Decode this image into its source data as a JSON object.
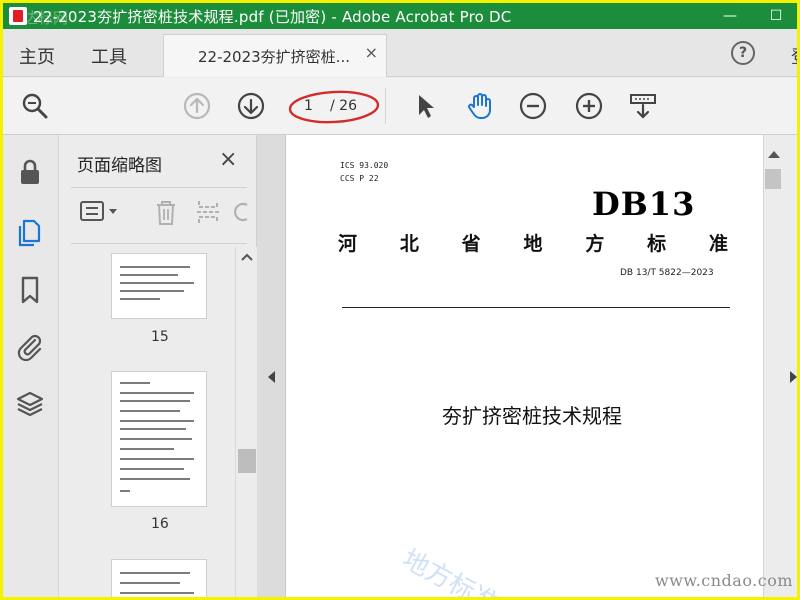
{
  "window": {
    "title": "22-2023夯扩挤密桩技术规程.pdf  (已加密)  - Adobe Acrobat Pro DC",
    "watermark": "达标网",
    "minimize": "—",
    "maximize": "☐"
  },
  "tabs": {
    "home": "主页",
    "tools": "工具",
    "document_tab": "22-2023夯扩挤密桩...",
    "close": "×",
    "help": "?",
    "overflow": "登"
  },
  "toolbar": {
    "current_page": "1",
    "total_pages": "/ 26",
    "icons": [
      "zoom-search-icon",
      "page-up-icon",
      "page-down-icon",
      "select-arrow-icon",
      "hand-icon",
      "zoom-out-icon",
      "zoom-in-icon",
      "keyboard-marquee-icon"
    ]
  },
  "panel": {
    "title": "页面缩略图",
    "close": "×",
    "thumbnails": [
      {
        "label": "15"
      },
      {
        "label": "16"
      }
    ]
  },
  "document": {
    "ics_line1": "ICS  93.020",
    "ics_line2": "CCS  P  22",
    "logo": "DB13",
    "province_chars": [
      "河",
      "北",
      "省",
      "地",
      "方",
      "标",
      "准"
    ],
    "standard_number": "DB 13/T  5822—2023",
    "title": "夯扩挤密桩技术规程",
    "watermark": "地方标准",
    "site_watermark": "www.cndao.com"
  },
  "colors": {
    "titlebar": "#1c8e3b",
    "accent_blue": "#1b74d6",
    "annotation_red": "#d42a2a",
    "frame": "#f5f200"
  }
}
